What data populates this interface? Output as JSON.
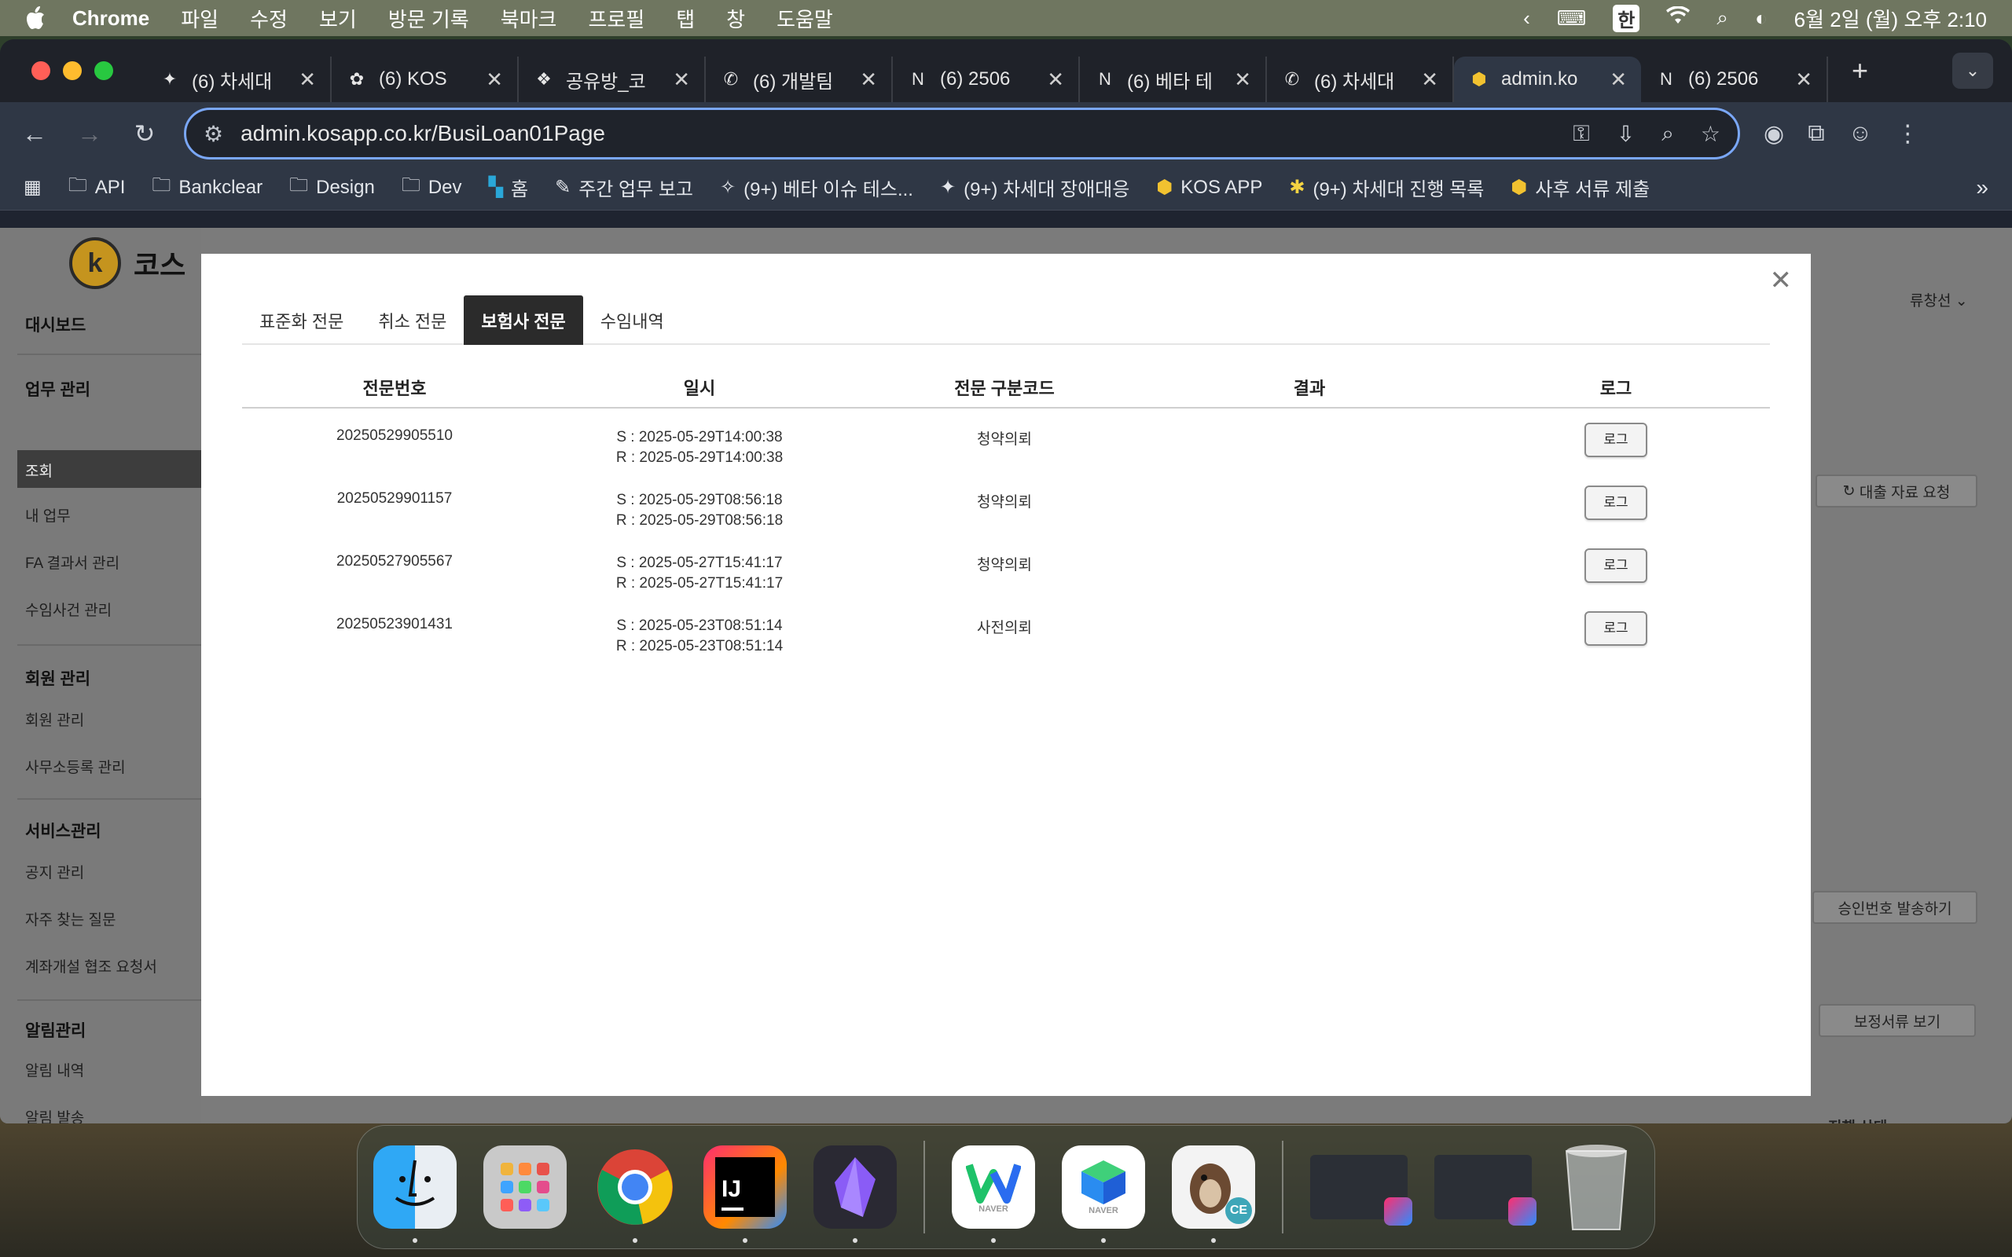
{
  "menubar": {
    "app_name": "Chrome",
    "menus": [
      "파일",
      "수정",
      "보기",
      "방문 기록",
      "북마크",
      "프로필",
      "탭",
      "창",
      "도움말"
    ],
    "ime": "한",
    "clock": "6월 2일 (월) 오후 2:10"
  },
  "browser": {
    "tabs": [
      {
        "title": "(6) 차세대",
        "icon": "sparkle-icon"
      },
      {
        "title": "(6) KOS",
        "icon": "flower-icon"
      },
      {
        "title": "공유방_코",
        "icon": "figma-icon"
      },
      {
        "title": "(6) 개발팀",
        "icon": "phone-icon"
      },
      {
        "title": "(6) 2506",
        "icon": "notion-icon"
      },
      {
        "title": "(6) 베타 테",
        "icon": "notion-icon"
      },
      {
        "title": "(6) 차세대",
        "icon": "phone-icon"
      },
      {
        "title": "admin.ko",
        "icon": "kos-icon",
        "active": true
      },
      {
        "title": "(6) 2506",
        "icon": "notion-icon"
      }
    ],
    "url": "admin.kosapp.co.kr/BusiLoan01Page",
    "bookmarks": [
      {
        "label": "API",
        "icon": "folder-icon"
      },
      {
        "label": "Bankclear",
        "icon": "folder-icon"
      },
      {
        "label": "Design",
        "icon": "folder-icon"
      },
      {
        "label": "Dev",
        "icon": "folder-icon"
      },
      {
        "label": "홈",
        "icon": "grid-icon"
      },
      {
        "label": "주간 업무 보고",
        "icon": "memo-icon"
      },
      {
        "label": "(9+) 베타 이슈 테스...",
        "icon": "pray-icon"
      },
      {
        "label": "(9+) 차세대 장애대응",
        "icon": "sparkle-icon"
      },
      {
        "label": "KOS APP",
        "icon": "kos-icon"
      },
      {
        "label": "(9+) 차세대 진행 목록",
        "icon": "bulb-icon"
      },
      {
        "label": "사후 서류 제출",
        "icon": "kos-icon"
      }
    ]
  },
  "page": {
    "logo_text": "코스",
    "user": "류창선",
    "sidebar": {
      "dashboard": "대시보드",
      "sections": [
        {
          "title": "업무 관리",
          "items": [
            "조회",
            "내 업무",
            "FA 결과서 관리",
            "수임사건 관리"
          ]
        },
        {
          "title": "회원 관리",
          "items": [
            "회원 관리",
            "사무소등록 관리"
          ]
        },
        {
          "title": "서비스관리",
          "items": [
            "공지 관리",
            "자주 찾는 질문",
            "계좌개설 협조 요청서"
          ]
        },
        {
          "title": "알림관리",
          "items": [
            "알림 내역",
            "알림 발송"
          ]
        }
      ]
    },
    "buttons": {
      "loan_request": "대출 자료 요청",
      "approval_issue": "승인번호 발송하기",
      "view_docs": "보정서류 보기"
    },
    "bottom_headers": {
      "progress": "진행 상태"
    }
  },
  "modal": {
    "tabs": [
      "표준화 전문",
      "취소 전문",
      "보험사 전문",
      "수임내역"
    ],
    "active_tab": 2,
    "columns": [
      "전문번호",
      "일시",
      "전문 구분코드",
      "결과",
      "로그"
    ],
    "rows": [
      {
        "id": "20250529905510",
        "sent": "S : 2025-05-29T14:00:38",
        "recv": "R : 2025-05-29T14:00:38",
        "code": "청약의뢰",
        "result": "",
        "log": "로그"
      },
      {
        "id": "20250529901157",
        "sent": "S : 2025-05-29T08:56:18",
        "recv": "R : 2025-05-29T08:56:18",
        "code": "청약의뢰",
        "result": "",
        "log": "로그"
      },
      {
        "id": "20250527905567",
        "sent": "S : 2025-05-27T15:41:17",
        "recv": "R : 2025-05-27T15:41:17",
        "code": "청약의뢰",
        "result": "",
        "log": "로그"
      },
      {
        "id": "20250523901431",
        "sent": "S : 2025-05-23T08:51:14",
        "recv": "R : 2025-05-23T08:51:14",
        "code": "사전의뢰",
        "result": "",
        "log": "로그"
      }
    ]
  },
  "dock": {
    "apps": [
      "finder-icon",
      "launchpad-icon",
      "chrome-icon",
      "intellij-icon",
      "obsidian-icon",
      "naver-whale-icon",
      "naver-works-icon",
      "dbeaver-icon"
    ],
    "whale_caption": "NAVER",
    "works_caption": "NAVER",
    "dbeaver_badge": "CE"
  },
  "colors": {
    "modal_active_tab": "#2b2b2b",
    "omnibox_focus": "#7aa7f7"
  }
}
